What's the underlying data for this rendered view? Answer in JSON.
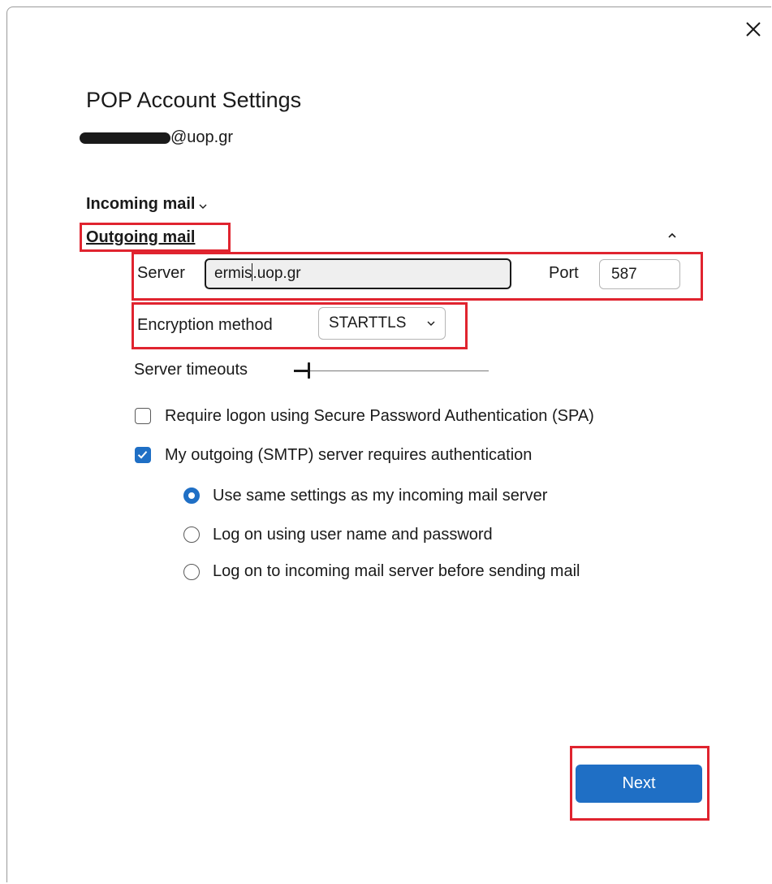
{
  "dialog": {
    "title": "POP Account Settings",
    "email_domain": "@uop.gr",
    "close_icon": "close-icon"
  },
  "incoming": {
    "label": "Incoming mail",
    "chevron": "⌄"
  },
  "outgoing": {
    "label": "Outgoing mail",
    "collapse_icon": "chevron-up-icon",
    "server_label": "Server",
    "server_value_before_caret": "ermis",
    "server_value_after_caret": ".uop.gr",
    "port_label": "Port",
    "port_value": "587",
    "encryption_label": "Encryption method",
    "encryption_value": "STARTTLS",
    "timeouts_label": "Server timeouts",
    "spa_label": "Require logon using Secure Password Authentication (SPA)",
    "spa_checked": false,
    "smtp_auth_label": "My outgoing (SMTP) server requires authentication",
    "smtp_auth_checked": true,
    "auth_options": [
      {
        "label": "Use same settings as my incoming mail server",
        "selected": true
      },
      {
        "label": "Log on using user name and password",
        "selected": false
      },
      {
        "label": "Log on to incoming mail server before sending mail",
        "selected": false
      }
    ]
  },
  "footer": {
    "next_label": "Next"
  },
  "colors": {
    "accent": "#1f6fc5",
    "highlight": "#e0242f"
  }
}
